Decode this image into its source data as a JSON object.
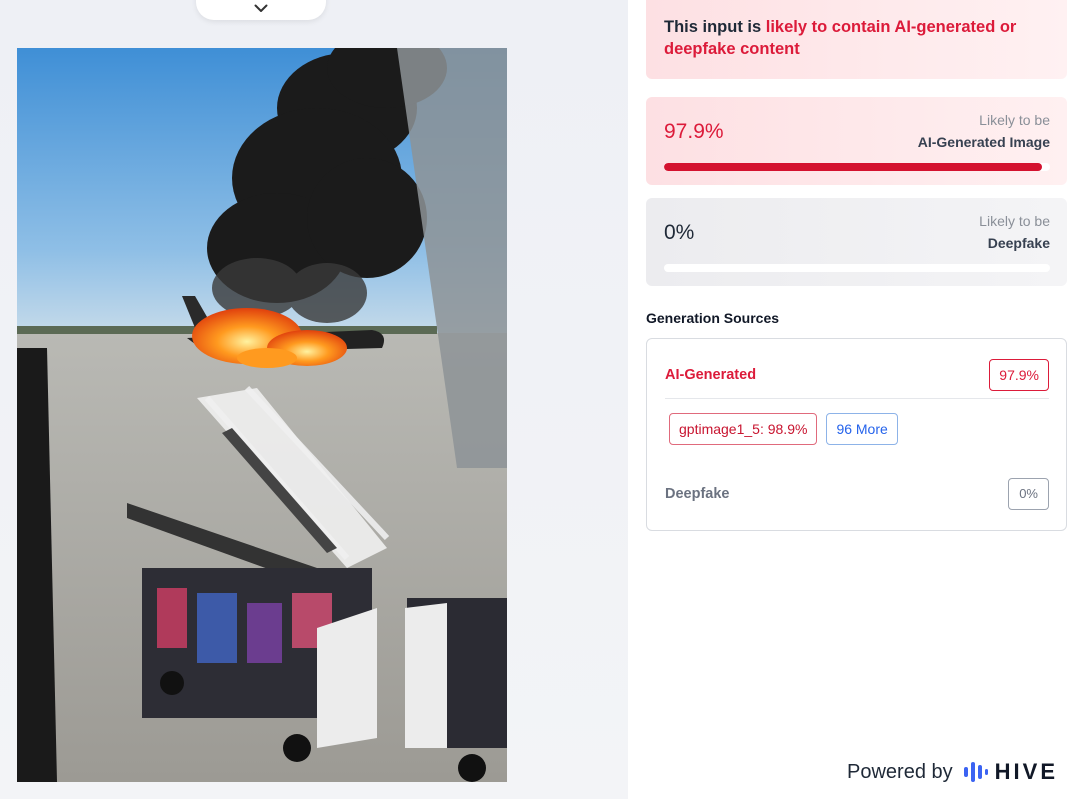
{
  "left": {
    "collapse_icon": "chevron-down-icon",
    "image_subject": "airplane-on-fire-photo"
  },
  "alert": {
    "prefix": "This input is ",
    "highlight": "likely to contain AI-generated or deepfake content",
    "color": "#dc1b3a"
  },
  "scores": {
    "ai": {
      "percent": "97.9%",
      "likely": "Likely to be",
      "type": "AI-Generated Image",
      "fill": 0.979,
      "color": "#d4122f"
    },
    "deepfake": {
      "percent": "0%",
      "likely": "Likely to be",
      "type": "Deepfake",
      "fill": 0
    }
  },
  "sources": {
    "title": "Generation Sources",
    "ai_label": "AI-Generated",
    "ai_value": "97.9%",
    "model_chip": "gptimage1_5: 98.9%",
    "more_chip": "96 More",
    "deepfake_label": "Deepfake",
    "deepfake_value": "0%"
  },
  "footer": {
    "powered_by": "Powered by",
    "brand": "HIVE",
    "brand_icon": "hive-logo-icon"
  }
}
